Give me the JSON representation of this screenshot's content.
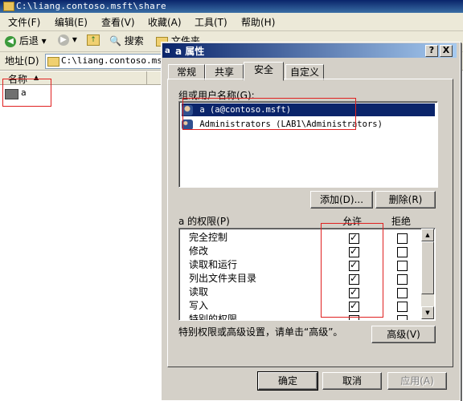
{
  "explorer": {
    "title": "C:\\liang.contoso.msft\\share",
    "menu": [
      "文件(F)",
      "编辑(E)",
      "查看(V)",
      "收藏(A)",
      "工具(T)",
      "帮助(H)"
    ],
    "toolbar": {
      "back": "后退",
      "search": "搜索",
      "folders": "文件夹"
    },
    "address_label": "地址(D)",
    "address_value": "C:\\liang.contoso.msft",
    "column_name": "名称",
    "files": [
      {
        "name": "a"
      }
    ]
  },
  "dialog": {
    "title": "a 属性",
    "help_btn": "?",
    "close_btn": "X",
    "tabs": [
      "常规",
      "共享",
      "安全",
      "自定义"
    ],
    "active_tab": "安全",
    "group_label": "组或用户名称(G):",
    "users": [
      {
        "name": "a (a@contoso.msft)",
        "selected": true
      },
      {
        "name": "Administrators (LAB1\\Administrators)",
        "selected": false
      }
    ],
    "add_button": "添加(D)...",
    "remove_button": "删除(R)",
    "perm_label": "a 的权限(P)",
    "allow_header": "允许",
    "deny_header": "拒绝",
    "permissions": [
      {
        "name": "完全控制",
        "allow": true,
        "deny": false
      },
      {
        "name": "修改",
        "allow": true,
        "deny": false
      },
      {
        "name": "读取和运行",
        "allow": true,
        "deny": false
      },
      {
        "name": "列出文件夹目录",
        "allow": true,
        "deny": false
      },
      {
        "name": "读取",
        "allow": true,
        "deny": false
      },
      {
        "name": "写入",
        "allow": true,
        "deny": false
      },
      {
        "name": "特别的权限",
        "allow": false,
        "deny": false
      }
    ],
    "advanced_text": "特别权限或高级设置，请单击“高级”。",
    "advanced_button": "高级(V)",
    "ok_button": "确定",
    "cancel_button": "取消",
    "apply_button": "应用(A)"
  },
  "colors": {
    "title_blue": "#0a246a",
    "highlight": "#0a246a",
    "annotation_red": "#e02020"
  }
}
